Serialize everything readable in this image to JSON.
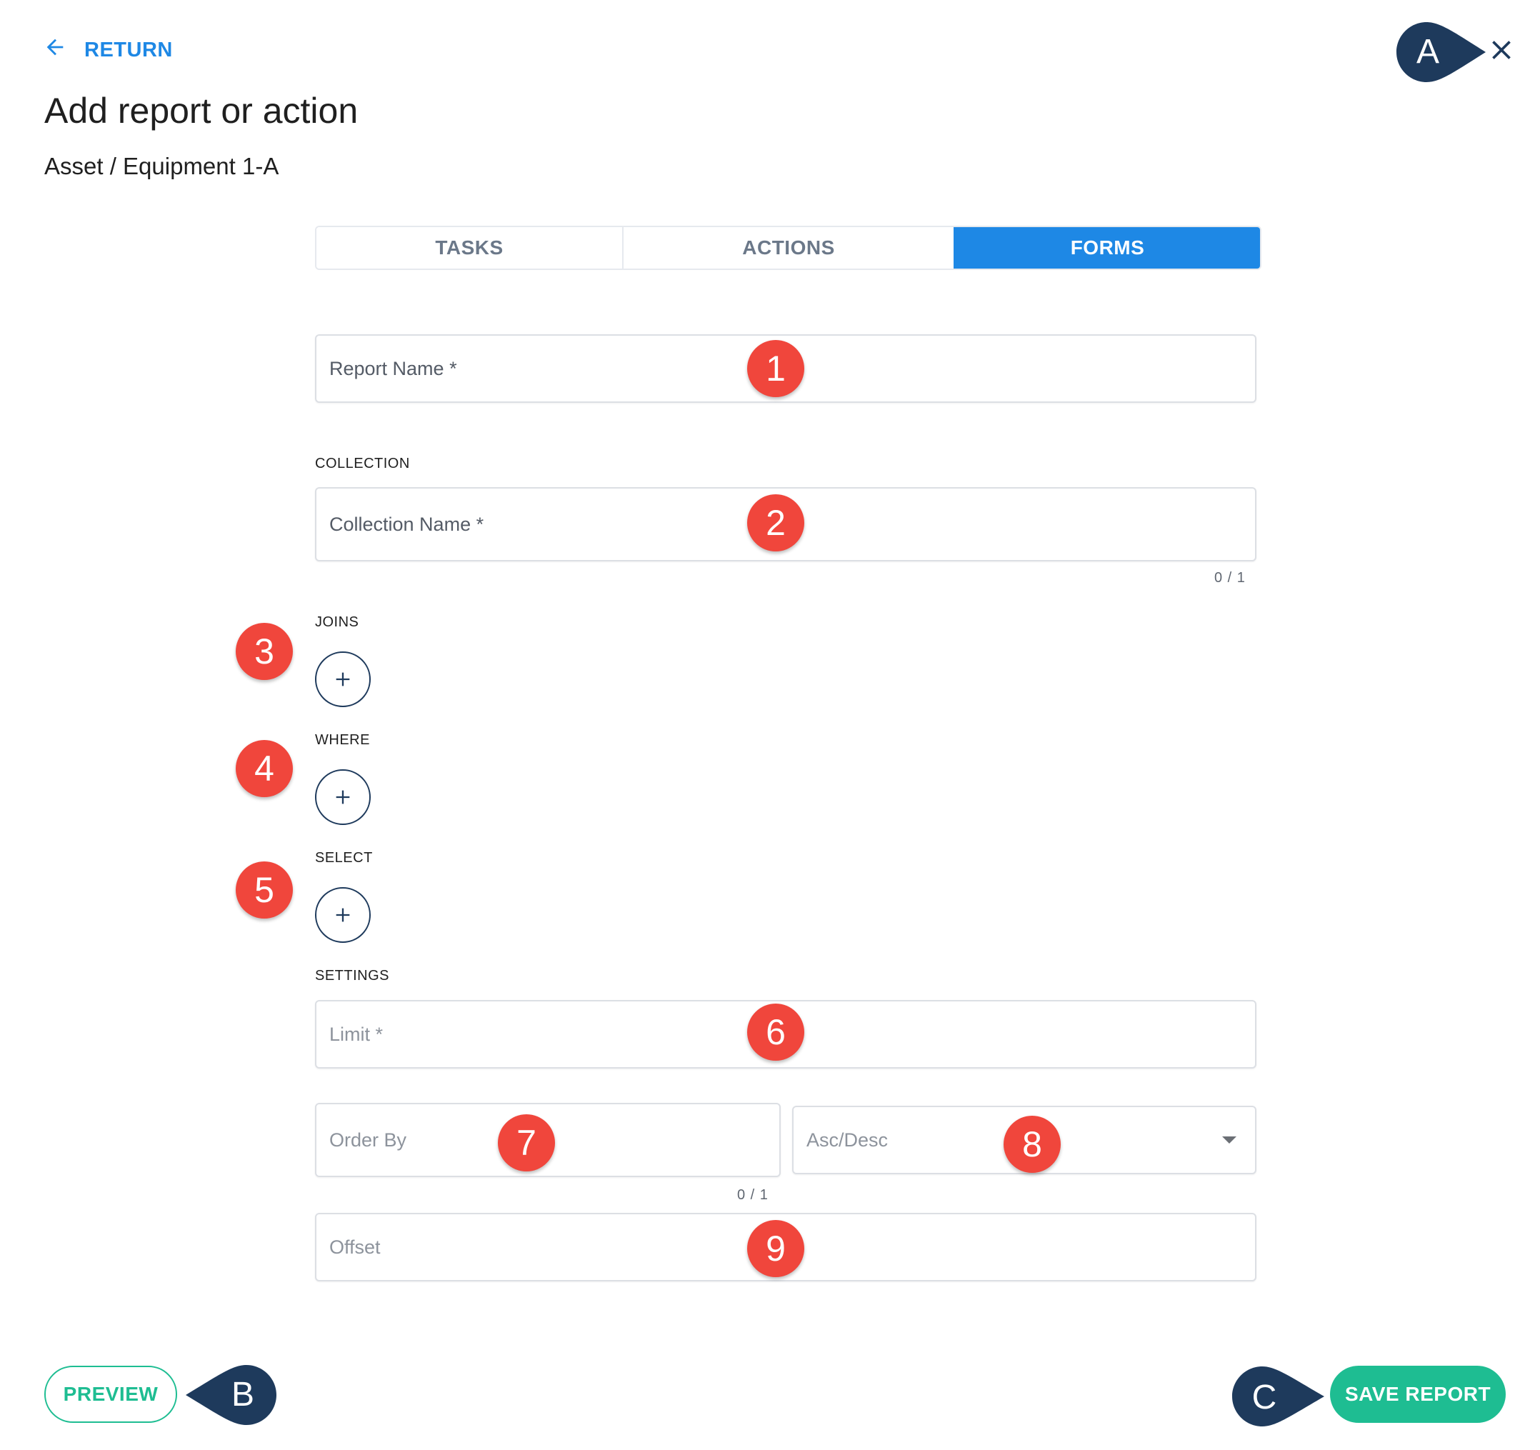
{
  "header": {
    "return_label": "RETURN",
    "title": "Add report or action",
    "breadcrumb": "Asset / Equipment 1-A",
    "close_icon": "close-icon"
  },
  "tabs": [
    {
      "label": "TASKS",
      "active": false
    },
    {
      "label": "ACTIONS",
      "active": false
    },
    {
      "label": "FORMS",
      "active": true
    }
  ],
  "form": {
    "report_name": {
      "placeholder": "Report Name *",
      "value": ""
    },
    "collection": {
      "label": "COLLECTION",
      "placeholder": "Collection Name *",
      "value": "",
      "counter": "0 / 1"
    },
    "joins": {
      "label": "JOINS",
      "add_icon": "plus-icon"
    },
    "where": {
      "label": "WHERE",
      "add_icon": "plus-icon"
    },
    "select": {
      "label": "SELECT",
      "add_icon": "plus-icon"
    },
    "settings": {
      "label": "SETTINGS",
      "limit": {
        "placeholder": "Limit *",
        "value": ""
      },
      "order_by": {
        "placeholder": "Order By",
        "value": "",
        "counter": "0 / 1"
      },
      "asc_desc": {
        "selected": "Asc/Desc"
      },
      "offset": {
        "placeholder": "Offset",
        "value": ""
      }
    }
  },
  "footer": {
    "preview_label": "PREVIEW",
    "save_label": "SAVE REPORT"
  },
  "annotations": {
    "numbered": [
      "1",
      "2",
      "3",
      "4",
      "5",
      "6",
      "7",
      "8",
      "9"
    ],
    "lettered": [
      "A",
      "B",
      "C"
    ]
  },
  "colors": {
    "primary": "#1e88e5",
    "accent_green": "#1ebd92",
    "marker_red": "#f0463c",
    "marker_navy": "#1e3a5c"
  }
}
